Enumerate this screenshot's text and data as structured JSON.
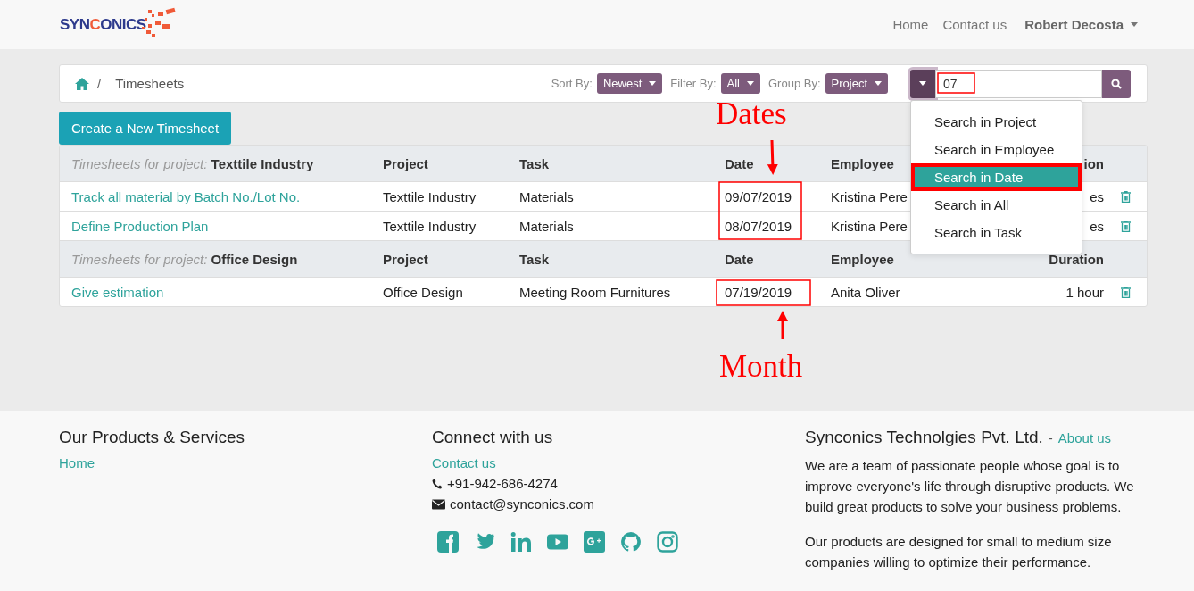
{
  "navbar": {
    "logo": {
      "before": "SYN",
      "accent": "C",
      "after": "ONICS"
    },
    "links": [
      "Home",
      "Contact us"
    ],
    "user": "Robert Decosta"
  },
  "breadcrumb": {
    "separator": "/",
    "current": "Timesheets"
  },
  "controls": [
    {
      "label": "Sort By:",
      "value": "Newest"
    },
    {
      "label": "Filter By:",
      "value": "All"
    },
    {
      "label": "Group By:",
      "value": "Project"
    }
  ],
  "search": {
    "value": "07",
    "menu_open": true,
    "menu": [
      {
        "label": "Search in Project",
        "selected": false
      },
      {
        "label": "Search in Employee",
        "selected": false
      },
      {
        "label": "Search in Date",
        "selected": true
      },
      {
        "label": "Search in All",
        "selected": false
      },
      {
        "label": "Search in Task",
        "selected": false
      }
    ]
  },
  "create_button": "Create a New Timesheet",
  "groups": [
    {
      "caption": "Timesheets for project:",
      "project": "Texttile Industry",
      "columns": [
        "Project",
        "Task",
        "Date",
        "Employee",
        "ion"
      ],
      "rows": [
        {
          "title": "Track all material by Batch No./Lot No.",
          "project": "Texttile Industry",
          "task": "Materials",
          "date": "09/07/2019",
          "employee": "Kristina Pere",
          "duration": "es"
        },
        {
          "title": "Define Production Plan",
          "project": "Texttile Industry",
          "task": "Materials",
          "date": "08/07/2019",
          "employee": "Kristina Pere",
          "duration": "es"
        }
      ]
    },
    {
      "caption": "Timesheets for project:",
      "project": "Office Design",
      "columns": [
        "Project",
        "Task",
        "Date",
        "Employee",
        "Duration"
      ],
      "rows": [
        {
          "title": "Give estimation",
          "project": "Office Design",
          "task": "Meeting Room Furnitures",
          "date": "07/19/2019",
          "employee": "Anita Oliver",
          "duration": "1 hour"
        }
      ]
    }
  ],
  "annotations": [
    "Dates",
    "Month"
  ],
  "footer": {
    "products": {
      "title": "Our Products & Services",
      "links": [
        "Home"
      ]
    },
    "connect": {
      "title": "Connect with us",
      "link": "Contact us",
      "phone": "+91-942-686-4274",
      "email": "contact@synconics.com"
    },
    "company": {
      "title": "Synconics Technolgies Pvt. Ltd.",
      "separator": "-",
      "link": "About us",
      "paragraphs": [
        "We are a team of passionate people whose goal is to improve everyone's life through disruptive products. We build great products to solve your business problems.",
        "Our products are designed for small to medium size companies willing to optimize their performance."
      ]
    }
  }
}
